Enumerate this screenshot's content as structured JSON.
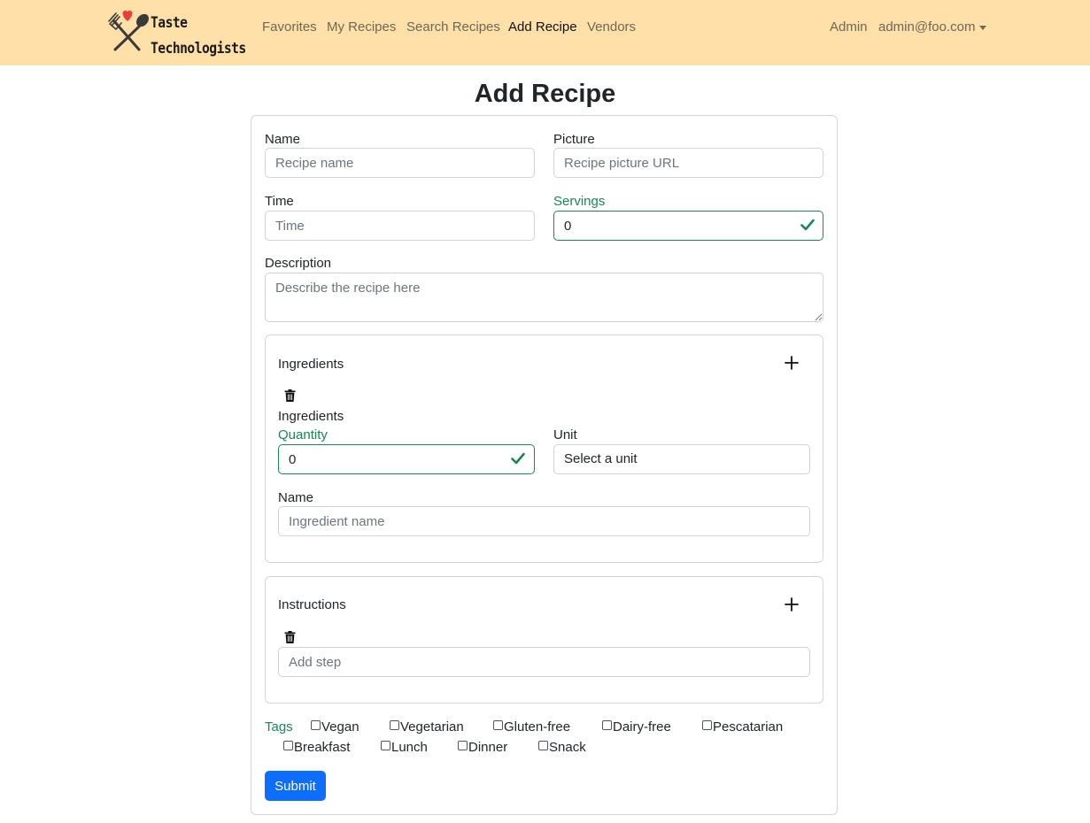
{
  "brand": {
    "line1": "Taste",
    "line2": "Technologists"
  },
  "nav": {
    "links": [
      "Favorites",
      "My Recipes",
      "Search Recipes",
      "Add Recipe",
      "Vendors"
    ],
    "active": "Add Recipe",
    "admin": "Admin",
    "user": "admin@foo.com"
  },
  "page": {
    "title": "Add Recipe"
  },
  "form": {
    "name": {
      "label": "Name",
      "placeholder": "Recipe name"
    },
    "picture": {
      "label": "Picture",
      "placeholder": "Recipe picture URL"
    },
    "time": {
      "label": "Time",
      "placeholder": "Time"
    },
    "servings": {
      "label": "Servings",
      "value": "0"
    },
    "description": {
      "label": "Description",
      "placeholder": "Describe the recipe here"
    },
    "ingredients": {
      "title": "Ingredients",
      "item_label": "Ingredients",
      "quantity": {
        "label": "Quantity",
        "value": "0"
      },
      "unit": {
        "label": "Unit",
        "value": "Select a unit"
      },
      "name": {
        "label": "Name",
        "placeholder": "Ingredient name"
      }
    },
    "instructions": {
      "title": "Instructions",
      "placeholder": "Add step"
    },
    "tags": {
      "label": "Tags",
      "options": [
        "Vegan",
        "Vegetarian",
        "Gluten-free",
        "Dairy-free",
        "Pescatarian",
        "Breakfast",
        "Lunch",
        "Dinner",
        "Snack"
      ]
    },
    "submit": "Submit"
  },
  "colors": {
    "navbar": "#ffe0a8",
    "valid": "#198754",
    "primary": "#0d6efd",
    "heart": "#e8413b"
  }
}
